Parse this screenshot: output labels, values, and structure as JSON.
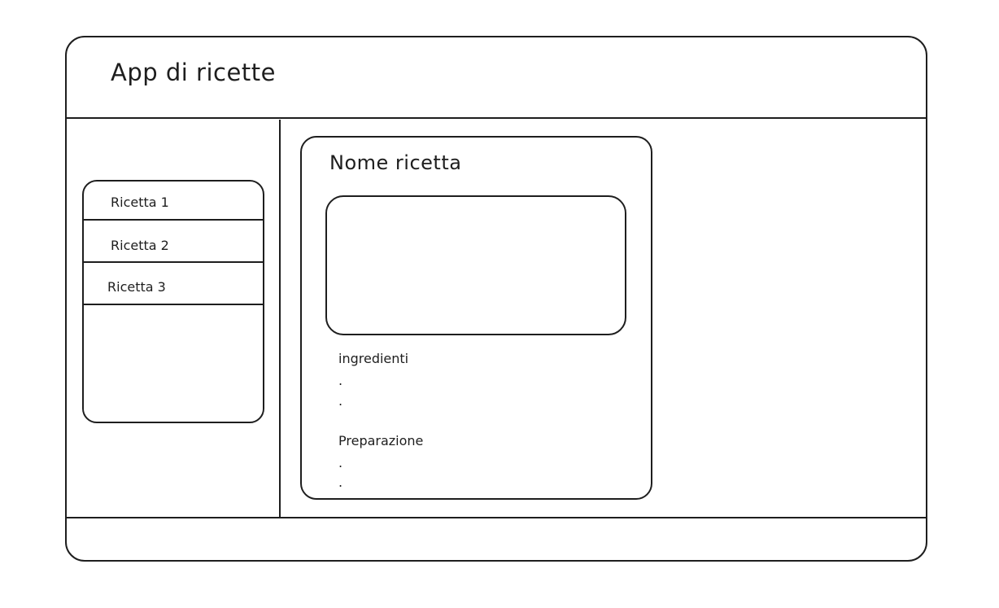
{
  "header": {
    "title": "App di ricette"
  },
  "sidebar": {
    "items": [
      {
        "label": "Ricetta 1"
      },
      {
        "label": "Ricetta 2"
      },
      {
        "label": "Ricetta 3"
      }
    ]
  },
  "recipe": {
    "name": "Nome ricetta",
    "ingredients_label": "ingredienti",
    "ingredients_bullets": [
      ".",
      "."
    ],
    "preparation_label": "Preparazione",
    "preparation_bullets": [
      ".",
      "."
    ]
  },
  "colors": {
    "stroke": "#1e1e1e",
    "background": "#ffffff"
  }
}
